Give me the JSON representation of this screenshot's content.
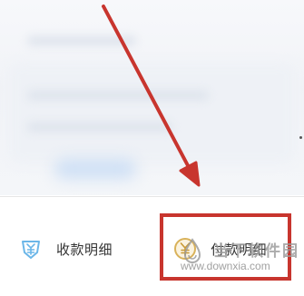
{
  "bottom_actions": {
    "receipt": {
      "label": "收款明细",
      "icon": "receipt-detail-icon",
      "icon_color": "#6bb6e8"
    },
    "payment": {
      "label": "付款明细",
      "icon": "payment-detail-icon",
      "icon_color": "#d9b25a"
    }
  },
  "annotation": {
    "color": "#c8352e"
  },
  "watermark": {
    "title": "当下软件园",
    "url": "www.downxia.com"
  }
}
